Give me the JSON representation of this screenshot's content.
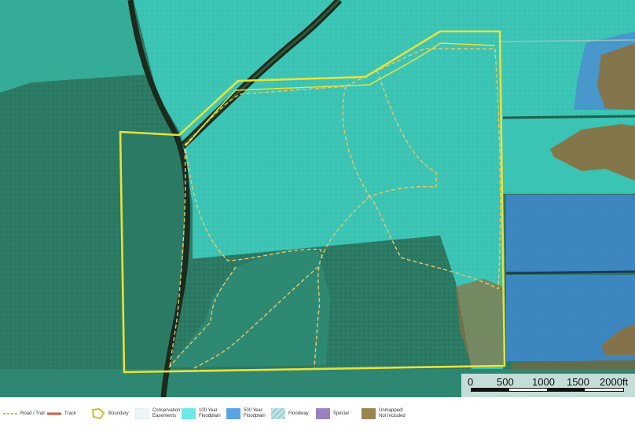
{
  "map": {
    "colors": {
      "forest": "#2b7a64",
      "floodplain_100": "#3fcfc0",
      "floodplain_500": "#4a8fd0",
      "unmapped": "#8a7140",
      "boundary": "#e8e23a",
      "trail": "#e6c86a",
      "track": "#1b2a1d",
      "floodway": "#8ac8c8",
      "special": "#9a82c0",
      "conservation": "#eef5f7"
    }
  },
  "scale": {
    "labels": [
      "0",
      "500",
      "1000",
      "1500",
      "2000ft"
    ]
  },
  "legend": {
    "items": [
      {
        "id": "road-trail",
        "label": "Road / Trail",
        "symbol": "dash",
        "icon": "dashed-line-icon"
      },
      {
        "id": "track",
        "label": "Track",
        "symbol": "line",
        "icon": "solid-line-icon"
      },
      {
        "id": "boundary",
        "label": "Boundary",
        "symbol": "boundary",
        "icon": "polygon-outline-icon"
      },
      {
        "id": "conservation-easements",
        "label": "Conservation\nEasements",
        "symbol": "swatch",
        "icon": "swatch-icon"
      },
      {
        "id": "floodplain-100",
        "label": "100 Year\nFloodplain",
        "symbol": "swatch",
        "icon": "swatch-icon"
      },
      {
        "id": "floodplain-500",
        "label": "500 Year\nFloodplain",
        "symbol": "swatch",
        "icon": "swatch-icon"
      },
      {
        "id": "floodway",
        "label": "Floodway",
        "symbol": "hatch",
        "icon": "hatched-swatch-icon"
      },
      {
        "id": "special",
        "label": "Special",
        "symbol": "swatch",
        "icon": "swatch-icon"
      },
      {
        "id": "unmapped",
        "label": "Unmapped/\nNot Included",
        "symbol": "swatch",
        "icon": "swatch-icon"
      }
    ]
  }
}
